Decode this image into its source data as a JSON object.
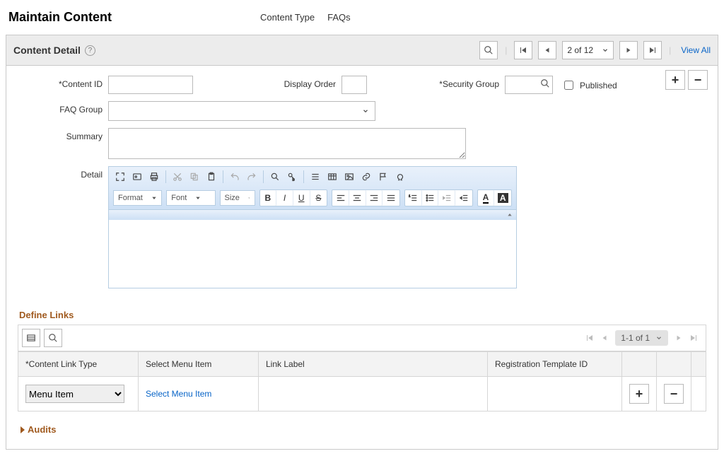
{
  "header": {
    "title": "Maintain Content",
    "content_type_label": "Content Type",
    "content_type_value": "FAQs"
  },
  "panel": {
    "title": "Content Detail",
    "pager": "2 of 12",
    "view_all": "View All"
  },
  "form": {
    "content_id_label": "*Content ID",
    "display_order_label": "Display Order",
    "security_group_label": "*Security Group",
    "published_label": "Published",
    "faq_group_label": "FAQ Group",
    "summary_label": "Summary",
    "detail_label": "Detail",
    "published_checked": false
  },
  "rte": {
    "format": "Format",
    "font": "Font",
    "size": "Size"
  },
  "links": {
    "section": "Define Links",
    "pager": "1-1 of 1",
    "col_type": "*Content Link Type",
    "col_menu": "Select Menu Item",
    "col_label": "Link Label",
    "col_reg": "Registration Template ID",
    "row_type_value": "Menu Item",
    "row_menu_link": "Select Menu Item"
  },
  "audits": {
    "label": "Audits"
  }
}
